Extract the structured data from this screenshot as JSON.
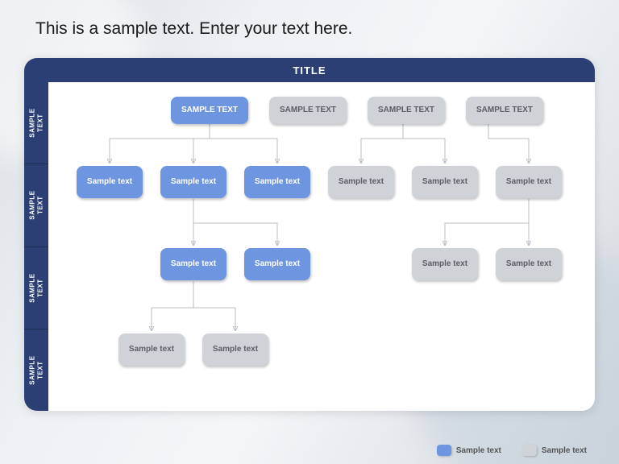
{
  "heading": "This is a sample text. Enter your text here.",
  "panel": {
    "title": "TITLE",
    "side_labels": [
      "SAMPLE\nTEXT",
      "SAMPLE\nTEXT",
      "SAMPLE\nTEXT",
      "SAMPLE\nTEXT"
    ],
    "row1": [
      {
        "label": "SAMPLE TEXT",
        "color": "blue"
      },
      {
        "label": "SAMPLE TEXT",
        "color": "gray"
      },
      {
        "label": "SAMPLE TEXT",
        "color": "gray"
      },
      {
        "label": "SAMPLE TEXT",
        "color": "gray"
      }
    ],
    "row2": [
      {
        "label": "Sample\ntext",
        "color": "blue"
      },
      {
        "label": "Sample\ntext",
        "color": "blue"
      },
      {
        "label": "Sample\ntext",
        "color": "blue"
      },
      {
        "label": "Sample\ntext",
        "color": "gray"
      },
      {
        "label": "Sample\ntext",
        "color": "gray"
      },
      {
        "label": "Sample\ntext",
        "color": "gray"
      }
    ],
    "row3": [
      {
        "label": "Sample\ntext",
        "color": "blue"
      },
      {
        "label": "Sample\ntext",
        "color": "blue"
      },
      {
        "label": "Sample\ntext",
        "color": "gray"
      },
      {
        "label": "Sample\ntext",
        "color": "gray"
      }
    ],
    "row4": [
      {
        "label": "Sample\ntext",
        "color": "gray"
      },
      {
        "label": "Sample\ntext",
        "color": "gray"
      }
    ]
  },
  "legend": {
    "blue": "Sample text",
    "gray": "Sample text"
  },
  "colors": {
    "accent": "#2b3f74",
    "blue_node": "#6d95e0",
    "gray_node": "#cfd3d8"
  }
}
